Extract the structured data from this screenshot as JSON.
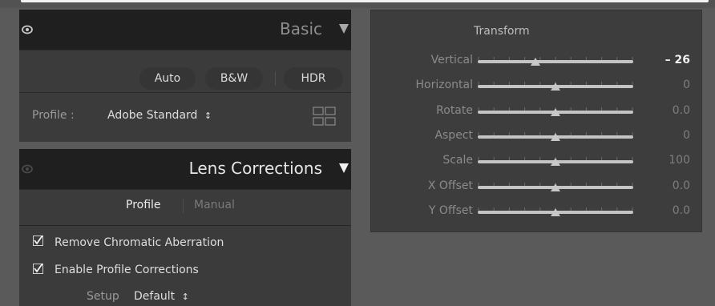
{
  "basic": {
    "title": "Basic",
    "buttons": {
      "auto": "Auto",
      "bw": "B&W",
      "hdr": "HDR"
    },
    "profile_label": "Profile :",
    "profile_value": "Adobe Standard",
    "profile_chevron": "↕"
  },
  "lens": {
    "title": "Lens Corrections",
    "tab_profile": "Profile",
    "tab_manual": "Manual",
    "remove_ca": {
      "label": "Remove Chromatic Aberration",
      "checked": true
    },
    "enable_profile": {
      "label": "Enable Profile Corrections",
      "checked": true
    },
    "setup_label": "Setup",
    "setup_value": "Default",
    "setup_chevron": "↕"
  },
  "transform": {
    "title": "Transform",
    "sliders": [
      {
        "label": "Vertical",
        "value": "– 26",
        "position": -26,
        "min": -100,
        "max": 100,
        "active": true
      },
      {
        "label": "Horizontal",
        "value": "0",
        "position": 0,
        "min": -100,
        "max": 100,
        "active": false
      },
      {
        "label": "Rotate",
        "value": "0.0",
        "position": 0,
        "min": -10,
        "max": 10,
        "active": false
      },
      {
        "label": "Aspect",
        "value": "0",
        "position": 0,
        "min": -100,
        "max": 100,
        "active": false
      },
      {
        "label": "Scale",
        "value": "100",
        "position": 100,
        "min": 50,
        "max": 150,
        "active": false
      },
      {
        "label": "X Offset",
        "value": "0.0",
        "position": 0,
        "min": -100,
        "max": 100,
        "active": false
      },
      {
        "label": "Y Offset",
        "value": "0.0",
        "position": 0,
        "min": -100,
        "max": 100,
        "active": false
      }
    ]
  },
  "colors": {
    "header_bg": "#1f1f1f",
    "panel_bg": "#3b3b3b",
    "transform_bg": "#3d3d3d",
    "track": "#c4c4c4",
    "active_value": "#efefef"
  }
}
